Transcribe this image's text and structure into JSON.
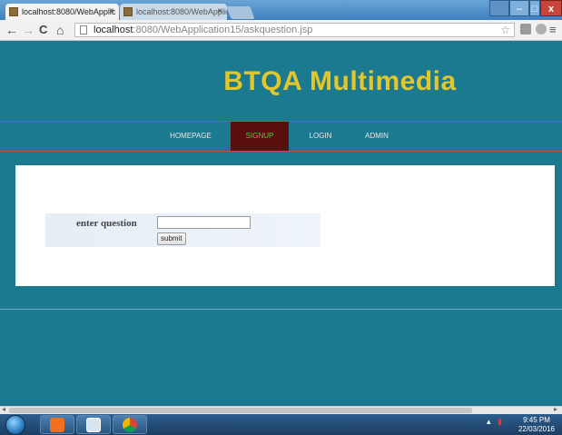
{
  "browser": {
    "tabs": [
      {
        "title": "localhost:8080/WebApplic",
        "close": "×",
        "active": true
      },
      {
        "title": "localhost:8080/WebApplic",
        "close": "×",
        "active": false
      }
    ],
    "window_controls": {
      "minimize": "–",
      "maximize": "□",
      "close": "x"
    },
    "nav": {
      "back": "←",
      "forward": "→",
      "reload": "C",
      "home": "⌂"
    },
    "address": {
      "host": "localhost",
      "rest": ":8080/WebApplication15/askquestion.jsp"
    },
    "bookmark_star": "☆",
    "menu_icon": "≡"
  },
  "site": {
    "brand": "BTQA Multimedia",
    "nav": [
      {
        "label": "HOMEPAGE"
      },
      {
        "label": "SIGNUP"
      },
      {
        "label": "LOGIN"
      },
      {
        "label": "ADMIN"
      }
    ]
  },
  "form": {
    "label": "enter question",
    "input_value": "",
    "submit_label": "submit"
  },
  "taskbar": {
    "time": "9:45 PM",
    "date": "22/03/2016"
  },
  "colors": {
    "page_bg": "#1b7a8f",
    "brand": "#e2c62b",
    "nav_active_bg": "#5a0e0e",
    "nav_active_text": "#33dd33",
    "nav_border": "#c04a4a"
  }
}
